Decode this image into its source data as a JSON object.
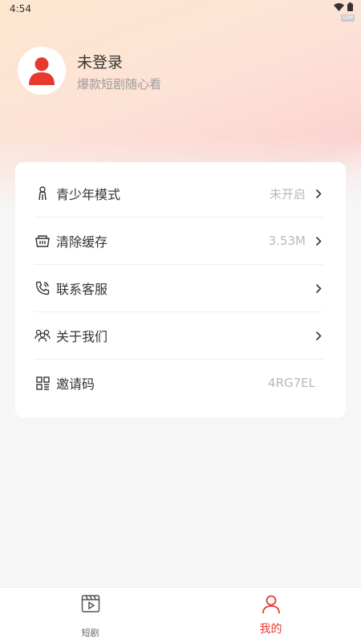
{
  "status_bar": {
    "time": "4:54",
    "tag": "UIM"
  },
  "profile": {
    "name": "未登录",
    "subtitle": "爆款短剧随心看"
  },
  "menu": {
    "items": [
      {
        "icon": "person-icon",
        "label": "青少年模式",
        "value": "未开启",
        "has_arrow": true
      },
      {
        "icon": "basket-icon",
        "label": "清除缓存",
        "value": "3.53M",
        "has_arrow": true
      },
      {
        "icon": "phone-icon",
        "label": "联系客服",
        "value": "",
        "has_arrow": true
      },
      {
        "icon": "group-icon",
        "label": "关于我们",
        "value": "",
        "has_arrow": true
      },
      {
        "icon": "qrcode-icon",
        "label": "邀请码",
        "value": "4RG7EL",
        "has_arrow": false
      }
    ]
  },
  "tabbar": {
    "tabs": [
      {
        "label": "短剧",
        "icon": "film-icon",
        "active": false
      },
      {
        "label": "我的",
        "icon": "person-icon",
        "active": true
      }
    ]
  },
  "colors": {
    "accent": "#e23b30",
    "text": "#333333",
    "muted": "#b8b8b8"
  }
}
